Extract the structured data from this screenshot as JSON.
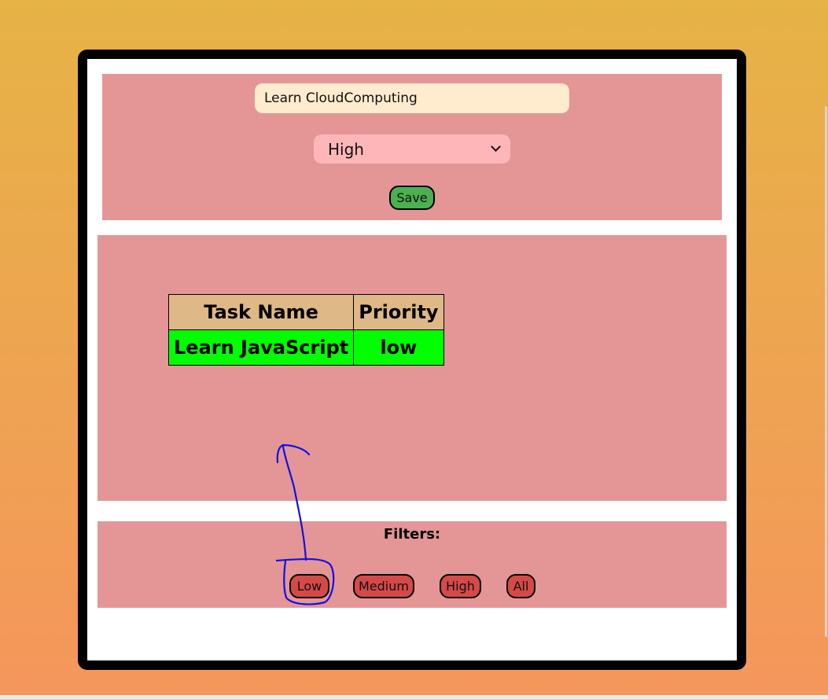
{
  "form": {
    "task_input_value": "Learn CloudComputing",
    "priority_selected": "High",
    "save_label": "Save"
  },
  "tasks_table": {
    "headers": [
      "Task Name",
      "Priority"
    ],
    "rows": [
      {
        "name": "Learn JavaScript",
        "priority": "low"
      }
    ]
  },
  "filters": {
    "title": "Filters:",
    "buttons": [
      "Low",
      "Medium",
      "High",
      "All"
    ]
  },
  "colors": {
    "page_gradient_top": "#e6b346",
    "page_gradient_bottom": "#f5965c",
    "panel": "#e49696",
    "input_bg": "#ffebcd",
    "select_bg": "#ffb6b9",
    "save_button": "#4caf50",
    "filter_button": "#d54a48",
    "table_header": "#deb887",
    "table_row": "#00ff00",
    "annotation_ink": "#1010e6"
  },
  "annotation": {
    "type": "hand-drawn circle and arrow",
    "target": "Low filter button"
  }
}
